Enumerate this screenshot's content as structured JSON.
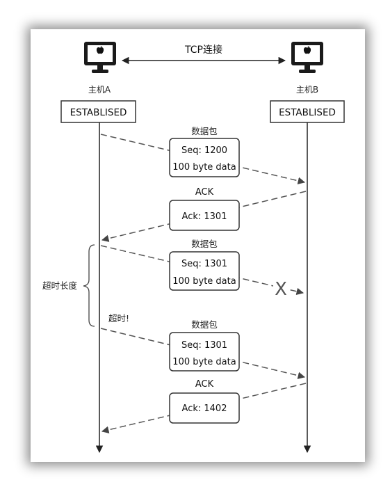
{
  "connection_label": "TCP连接",
  "host_a": {
    "name": "主机A",
    "state": "ESTABLISED"
  },
  "host_b": {
    "name": "主机B",
    "state": "ESTABLISED"
  },
  "messages": [
    {
      "title": "数据包",
      "line1": "Seq: 1200",
      "line2": "100 byte data"
    },
    {
      "title": "ACK",
      "line1": "Ack: 1301",
      "line2": ""
    },
    {
      "title": "数据包",
      "line1": "Seq: 1301",
      "line2": "100 byte data"
    },
    {
      "title": "数据包",
      "line1": "Seq: 1301",
      "line2": "100 byte data"
    },
    {
      "title": "ACK",
      "line1": "Ack: 1402",
      "line2": ""
    }
  ],
  "loss_mark": "X",
  "timeout_span_label": "超时长度",
  "timeout_event_label": "超时!",
  "icons": {
    "host": "computer-monitor-apple-icon"
  },
  "colors": {
    "line": "#222222",
    "dash": "#555555",
    "box_border": "#333333"
  }
}
